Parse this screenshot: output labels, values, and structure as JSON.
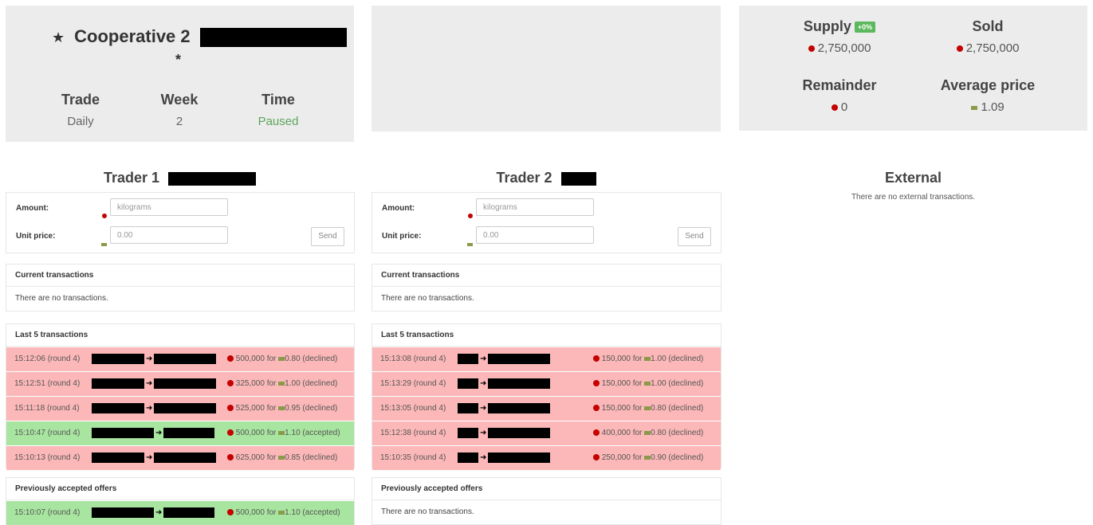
{
  "coop": {
    "star": "★",
    "title": "Cooperative 2",
    "star2": "*",
    "trade_label": "Trade",
    "trade_value": "Daily",
    "week_label": "Week",
    "week_value": "2",
    "time_label": "Time",
    "time_value": "Paused"
  },
  "stats": {
    "supply_label": "Supply",
    "supply_badge": "+0%",
    "supply_value": "2,750,000",
    "sold_label": "Sold",
    "sold_value": "2,750,000",
    "remainder_label": "Remainder",
    "remainder_value": "0",
    "avg_label": "Average price",
    "avg_value": "1.09"
  },
  "trader1": {
    "title": "Trader 1",
    "amount_label": "Amount:",
    "amount_placeholder": "kilograms",
    "price_label": "Unit price:",
    "price_value": "0.00",
    "send_label": "Send",
    "current_head": "Current transactions",
    "current_empty": "There are no transactions.",
    "last_head": "Last 5 transactions",
    "last_rows": [
      {
        "time": "15:12:06 (round 4)",
        "amount": "500,000 for",
        "price": "0.80",
        "status": "(declined)",
        "state": "declined"
      },
      {
        "time": "15:12:51 (round 4)",
        "amount": "325,000 for",
        "price": "1.00",
        "status": "(declined)",
        "state": "declined"
      },
      {
        "time": "15:11:18 (round 4)",
        "amount": "525,000 for",
        "price": "0.95",
        "status": "(declined)",
        "state": "declined"
      },
      {
        "time": "15:10:47 (round 4)",
        "amount": "500,000 for",
        "price": "1.10",
        "status": "(accepted)",
        "state": "accepted"
      },
      {
        "time": "15:10:13 (round 4)",
        "amount": "625,000 for",
        "price": "0.85",
        "status": "(declined)",
        "state": "declined"
      }
    ],
    "prev_head": "Previously accepted offers",
    "prev_rows": [
      {
        "time": "15:10:07 (round 4)",
        "amount": "500,000 for",
        "price": "1.10",
        "status": "(accepted)",
        "state": "accepted"
      }
    ]
  },
  "trader2": {
    "title": "Trader 2",
    "amount_label": "Amount:",
    "amount_placeholder": "kilograms",
    "price_label": "Unit price:",
    "price_value": "0.00",
    "send_label": "Send",
    "current_head": "Current transactions",
    "current_empty": "There are no transactions.",
    "last_head": "Last 5 transactions",
    "last_rows": [
      {
        "time": "15:13:08 (round 4)",
        "amount": "150,000 for",
        "price": "1.00",
        "status": "(declined)",
        "state": "declined"
      },
      {
        "time": "15:13:29 (round 4)",
        "amount": "150,000 for",
        "price": "1.00",
        "status": "(declined)",
        "state": "declined"
      },
      {
        "time": "15:13:05 (round 4)",
        "amount": "150,000 for",
        "price": "0.80",
        "status": "(declined)",
        "state": "declined"
      },
      {
        "time": "15:12:38 (round 4)",
        "amount": "400,000 for",
        "price": "0.80",
        "status": "(declined)",
        "state": "declined"
      },
      {
        "time": "15:10:35 (round 4)",
        "amount": "250,000 for",
        "price": "0.90",
        "status": "(declined)",
        "state": "declined"
      }
    ],
    "prev_head": "Previously accepted offers",
    "prev_empty": "There are no transactions."
  },
  "external": {
    "title": "External",
    "empty": "There are no external transactions."
  },
  "colors": {
    "declined_row": "#fcb8b8",
    "accepted_row": "#a8e5a0",
    "panel_bg": "#ececec",
    "cube_red": "#c40000",
    "badge_green": "#5cb85c"
  },
  "icons": {
    "cube": "cube-icon",
    "money": "money-icon",
    "arrow": "arrow-right-icon"
  }
}
